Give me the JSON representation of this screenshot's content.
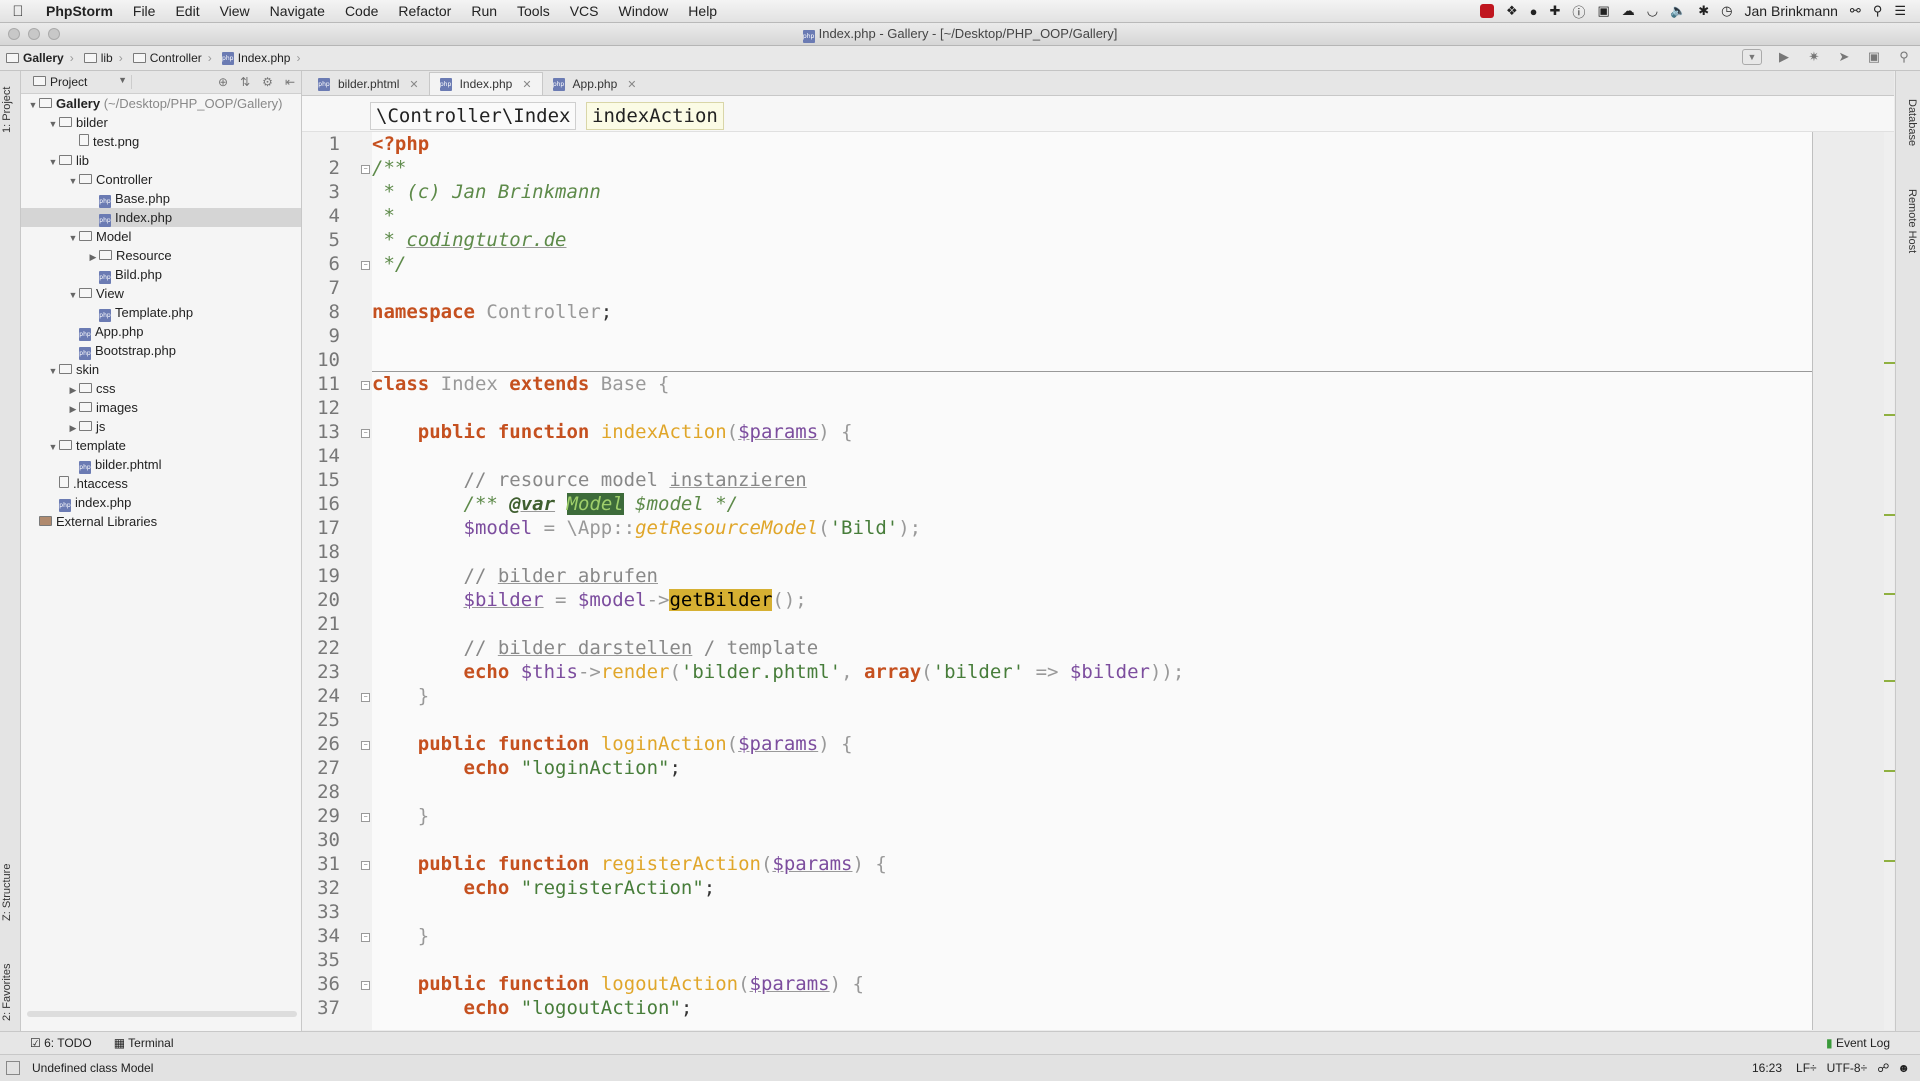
{
  "menubar": {
    "app": "PhpStorm",
    "items": [
      "File",
      "Edit",
      "View",
      "Navigate",
      "Code",
      "Refactor",
      "Run",
      "Tools",
      "VCS",
      "Window",
      "Help"
    ],
    "user": "Jan Brinkmann"
  },
  "window": {
    "title": "Index.php - Gallery - [~/Desktop/PHP_OOP/Gallery]"
  },
  "navbar": {
    "crumbs": [
      "Gallery",
      "lib",
      "Controller",
      "Index.php"
    ]
  },
  "project": {
    "selector": "Project",
    "tree": [
      {
        "label": "Gallery",
        "extra": " (~/Desktop/PHP_OOP/Gallery)",
        "depth": 0,
        "kind": "folder",
        "open": true,
        "bold": true
      },
      {
        "label": "bilder",
        "depth": 1,
        "kind": "folder",
        "open": true
      },
      {
        "label": "test.png",
        "depth": 2,
        "kind": "file"
      },
      {
        "label": "lib",
        "depth": 1,
        "kind": "folder",
        "open": true
      },
      {
        "label": "Controller",
        "depth": 2,
        "kind": "folder",
        "open": true
      },
      {
        "label": "Base.php",
        "depth": 3,
        "kind": "php"
      },
      {
        "label": "Index.php",
        "depth": 3,
        "kind": "php",
        "selected": true
      },
      {
        "label": "Model",
        "depth": 2,
        "kind": "folder",
        "open": true
      },
      {
        "label": "Resource",
        "depth": 3,
        "kind": "folder",
        "open": false
      },
      {
        "label": "Bild.php",
        "depth": 3,
        "kind": "php"
      },
      {
        "label": "View",
        "depth": 2,
        "kind": "folder",
        "open": true
      },
      {
        "label": "Template.php",
        "depth": 3,
        "kind": "php"
      },
      {
        "label": "App.php",
        "depth": 2,
        "kind": "php"
      },
      {
        "label": "Bootstrap.php",
        "depth": 2,
        "kind": "php"
      },
      {
        "label": "skin",
        "depth": 1,
        "kind": "folder",
        "open": true
      },
      {
        "label": "css",
        "depth": 2,
        "kind": "folder",
        "open": false
      },
      {
        "label": "images",
        "depth": 2,
        "kind": "folder",
        "open": false
      },
      {
        "label": "js",
        "depth": 2,
        "kind": "folder",
        "open": false
      },
      {
        "label": "template",
        "depth": 1,
        "kind": "folder",
        "open": true
      },
      {
        "label": "bilder.phtml",
        "depth": 2,
        "kind": "php"
      },
      {
        "label": ".htaccess",
        "depth": 1,
        "kind": "file"
      },
      {
        "label": "index.php",
        "depth": 1,
        "kind": "php"
      },
      {
        "label": "External Libraries",
        "depth": 0,
        "kind": "lib"
      }
    ]
  },
  "editor_tabs": [
    {
      "label": "bilder.phtml",
      "active": false
    },
    {
      "label": "Index.php",
      "active": true
    },
    {
      "label": "App.php",
      "active": false
    }
  ],
  "editor_breadcrumb": {
    "ns": "\\Controller\\Index",
    "method": "indexAction"
  },
  "code_lines": [
    [
      [
        "kw",
        "<?php"
      ]
    ],
    [
      [
        "cmt",
        "/**"
      ]
    ],
    [
      [
        "cmt",
        " * (c) Jan Brinkmann"
      ]
    ],
    [
      [
        "cmt",
        " *"
      ]
    ],
    [
      [
        "cmt",
        " * "
      ],
      [
        "cmtul",
        "codingtutor.de"
      ]
    ],
    [
      [
        "cmt",
        " */"
      ]
    ],
    [],
    [
      [
        "kw",
        "namespace"
      ],
      [
        "dim",
        " Controller"
      ],
      [
        "plain",
        ";"
      ]
    ],
    [],
    [],
    [
      [
        "kw",
        "class"
      ],
      [
        "dim",
        " Index "
      ],
      [
        "kw",
        "extends"
      ],
      [
        "dim",
        " Base {"
      ]
    ],
    [],
    [
      [
        "plain",
        "    "
      ],
      [
        "kw",
        "public function"
      ],
      [
        "plain",
        " "
      ],
      [
        "fn",
        "indexAction"
      ],
      [
        "dim",
        "("
      ],
      [
        "varul",
        "$params"
      ],
      [
        "dim",
        ") {"
      ]
    ],
    [],
    [
      [
        "plain",
        "        "
      ],
      [
        "lcmt",
        "// resource model "
      ],
      [
        "lcmtul",
        "instanzieren"
      ]
    ],
    [
      [
        "plain",
        "        "
      ],
      [
        "cmt",
        "/** "
      ],
      [
        "cmttag",
        "@var"
      ],
      [
        "cmt",
        " "
      ],
      [
        "hlmodel",
        "Model"
      ],
      [
        "cmt",
        " $model */"
      ]
    ],
    [
      [
        "plain",
        "        "
      ],
      [
        "var",
        "$model"
      ],
      [
        "dim",
        " = \\App::"
      ],
      [
        "fnit",
        "getResourceModel"
      ],
      [
        "dim",
        "("
      ],
      [
        "str",
        "'Bild'"
      ],
      [
        "dim",
        ");"
      ]
    ],
    [],
    [
      [
        "plain",
        "        "
      ],
      [
        "lcmt",
        "// "
      ],
      [
        "lcmtul",
        "bilder abrufen"
      ]
    ],
    [
      [
        "plain",
        "        "
      ],
      [
        "varul",
        "$bilder"
      ],
      [
        "dim",
        " = "
      ],
      [
        "var",
        "$model"
      ],
      [
        "dim",
        "->"
      ],
      [
        "hl",
        "getBilder"
      ],
      [
        "dim",
        "();"
      ]
    ],
    [],
    [
      [
        "plain",
        "        "
      ],
      [
        "lcmt",
        "// "
      ],
      [
        "lcmtul",
        "bilder darstellen"
      ],
      [
        "lcmt",
        " / template"
      ]
    ],
    [
      [
        "plain",
        "        "
      ],
      [
        "kw",
        "echo"
      ],
      [
        "plain",
        " "
      ],
      [
        "var",
        "$this"
      ],
      [
        "dim",
        "->"
      ],
      [
        "fn",
        "render"
      ],
      [
        "dim",
        "("
      ],
      [
        "str",
        "'bilder.phtml'"
      ],
      [
        "dim",
        ", "
      ],
      [
        "kw",
        "array"
      ],
      [
        "dim",
        "("
      ],
      [
        "str",
        "'bilder'"
      ],
      [
        "dim",
        " => "
      ],
      [
        "var",
        "$bilder"
      ],
      [
        "dim",
        "));"
      ]
    ],
    [
      [
        "dim",
        "    }"
      ]
    ],
    [],
    [
      [
        "plain",
        "    "
      ],
      [
        "kw",
        "public function"
      ],
      [
        "plain",
        " "
      ],
      [
        "fn",
        "loginAction"
      ],
      [
        "dim",
        "("
      ],
      [
        "varul",
        "$params"
      ],
      [
        "dim",
        ") {"
      ]
    ],
    [
      [
        "plain",
        "        "
      ],
      [
        "kw",
        "echo"
      ],
      [
        "plain",
        " "
      ],
      [
        "str",
        "\"loginAction\""
      ],
      [
        "plain",
        ";"
      ]
    ],
    [],
    [
      [
        "dim",
        "    }"
      ]
    ],
    [],
    [
      [
        "plain",
        "    "
      ],
      [
        "kw",
        "public function"
      ],
      [
        "plain",
        " "
      ],
      [
        "fn",
        "registerAction"
      ],
      [
        "dim",
        "("
      ],
      [
        "varul",
        "$params"
      ],
      [
        "dim",
        ") {"
      ]
    ],
    [
      [
        "plain",
        "        "
      ],
      [
        "kw",
        "echo"
      ],
      [
        "plain",
        " "
      ],
      [
        "str",
        "\"registerAction\""
      ],
      [
        "plain",
        ";"
      ]
    ],
    [],
    [
      [
        "dim",
        "    }"
      ]
    ],
    [],
    [
      [
        "plain",
        "    "
      ],
      [
        "kw",
        "public function"
      ],
      [
        "plain",
        " "
      ],
      [
        "fn",
        "logoutAction"
      ],
      [
        "dim",
        "("
      ],
      [
        "varul",
        "$params"
      ],
      [
        "dim",
        ") {"
      ]
    ],
    [
      [
        "plain",
        "        "
      ],
      [
        "kw",
        "echo"
      ],
      [
        "plain",
        " "
      ],
      [
        "str",
        "\"logoutAction\""
      ],
      [
        "plain",
        ";"
      ]
    ],
    []
  ],
  "bottom_tabs": [
    {
      "label": "6: TODO"
    },
    {
      "label": "Terminal"
    }
  ],
  "event_log": "Event Log",
  "left_tools": [
    "1: Project",
    "Z: Structure",
    "2: Favorites"
  ],
  "right_tools": [
    "Database",
    "Remote Host"
  ],
  "status": {
    "message": "Undefined class Model",
    "position": "16:23",
    "line_sep": "LF÷",
    "encoding": "UTF-8÷"
  }
}
